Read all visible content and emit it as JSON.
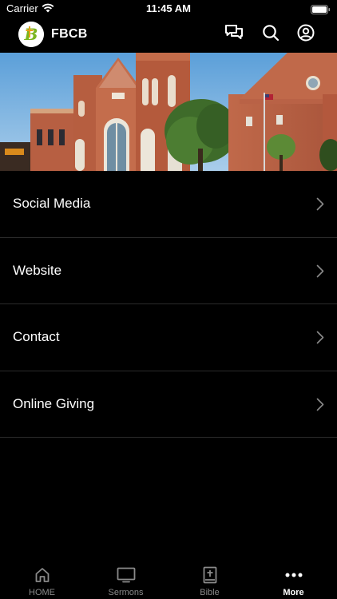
{
  "status_bar": {
    "carrier": "Carrier",
    "time": "11:45 AM"
  },
  "header": {
    "title": "FBCB",
    "icons": [
      "chat-bubbles-icon",
      "search-icon",
      "account-icon"
    ]
  },
  "menu": {
    "items": [
      {
        "label": "Social Media"
      },
      {
        "label": "Website"
      },
      {
        "label": "Contact"
      },
      {
        "label": "Online Giving"
      }
    ]
  },
  "tab_bar": {
    "tabs": [
      {
        "label": "HOME",
        "icon": "home-icon"
      },
      {
        "label": "Sermons",
        "icon": "tv-icon"
      },
      {
        "label": "Bible",
        "icon": "bible-icon"
      },
      {
        "label": "More",
        "icon": "more-dots-icon"
      }
    ],
    "active": "More"
  },
  "colors": {
    "background": "#000000",
    "divider": "#2b2b2b",
    "logo_green": "#7ab51d",
    "tab_inactive": "#8a8a8a"
  }
}
